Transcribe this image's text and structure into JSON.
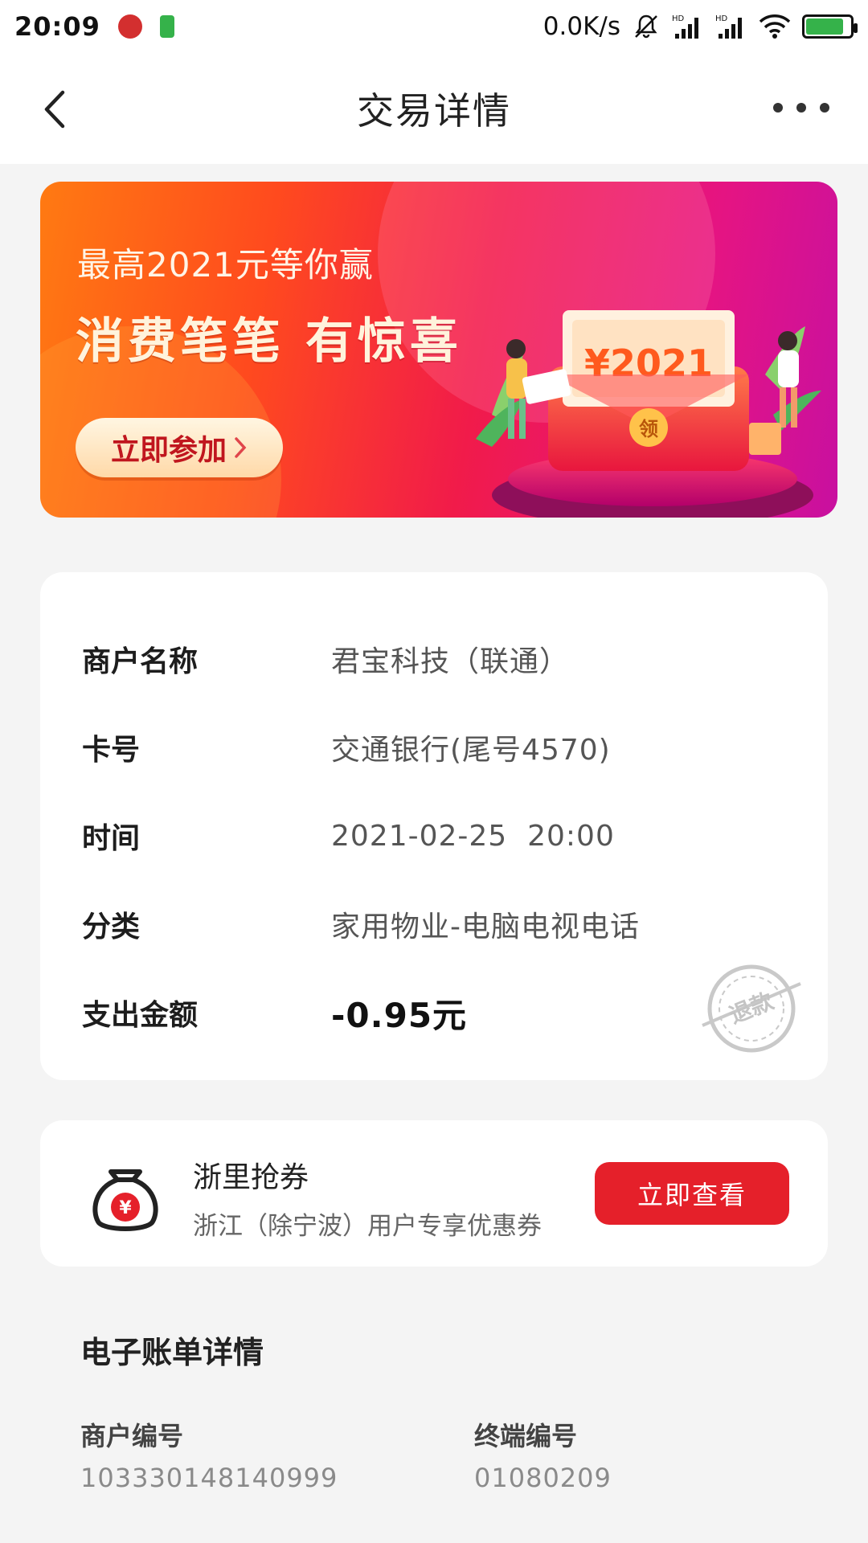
{
  "status_bar": {
    "time": "20:09",
    "network_speed": "0.0K/s",
    "icons": [
      "app-notification-icon",
      "battery-saver-icon",
      "mute-icon",
      "signal-hd-icon",
      "signal-hd-icon",
      "wifi-icon",
      "battery-charging-icon"
    ],
    "battery_level": 0.85
  },
  "header": {
    "title": "交易详情",
    "back_icon": "chevron-left-icon",
    "more_icon": "more-dots-icon"
  },
  "banner": {
    "subtitle": "最高2021元等你赢",
    "headline": "消费笔笔 有惊喜",
    "cta_label": "立即参加",
    "prize_amount": "¥2021",
    "envelope_badge": "领",
    "colors": {
      "start": "#ff7a12",
      "mid": "#f11b4a",
      "end": "#c810a0"
    }
  },
  "transaction": {
    "rows": [
      {
        "label": "商户名称",
        "value": "君宝科技（联通）"
      },
      {
        "label": "卡号",
        "value": "交通银行(尾号4570)"
      },
      {
        "label": "时间",
        "value": "2021-02-25  20:00"
      },
      {
        "label": "分类",
        "value": "家用物业-电脑电视电话"
      },
      {
        "label": "支出金额",
        "value": "-0.95元"
      }
    ],
    "refund_stamp": "退款"
  },
  "coupon": {
    "icon": "money-bag-icon",
    "title": "浙里抢券",
    "description": "浙江（除宁波）用户专享优惠券",
    "button_label": "立即查看",
    "accent": "#e5202a"
  },
  "ebill": {
    "title": "电子账单详情",
    "merchant_no_label": "商户编号",
    "merchant_no": "103330148140999",
    "terminal_no_label": "终端编号",
    "terminal_no": "01080209"
  }
}
